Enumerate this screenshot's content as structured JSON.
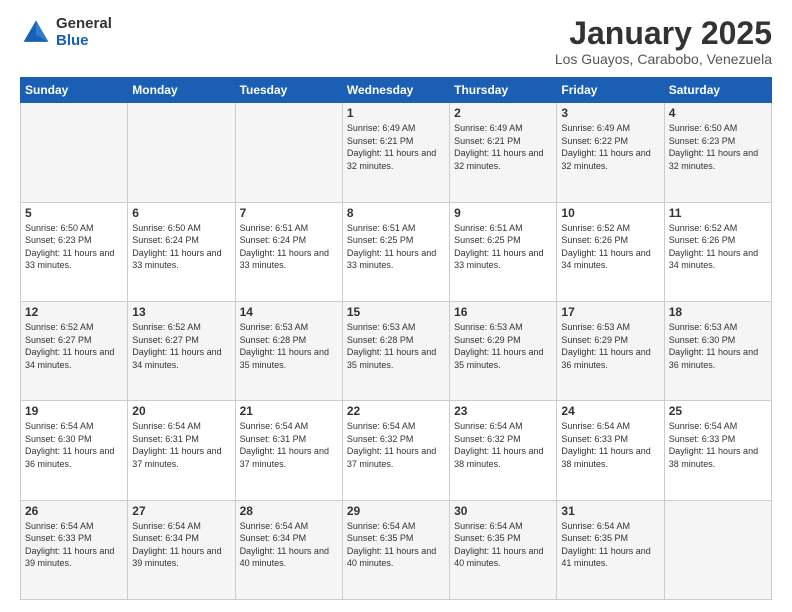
{
  "header": {
    "logo_general": "General",
    "logo_blue": "Blue",
    "title": "January 2025",
    "subtitle": "Los Guayos, Carabobo, Venezuela"
  },
  "weekdays": [
    "Sunday",
    "Monday",
    "Tuesday",
    "Wednesday",
    "Thursday",
    "Friday",
    "Saturday"
  ],
  "weeks": [
    [
      {
        "day": "",
        "info": ""
      },
      {
        "day": "",
        "info": ""
      },
      {
        "day": "",
        "info": ""
      },
      {
        "day": "1",
        "info": "Sunrise: 6:49 AM\nSunset: 6:21 PM\nDaylight: 11 hours and 32 minutes."
      },
      {
        "day": "2",
        "info": "Sunrise: 6:49 AM\nSunset: 6:21 PM\nDaylight: 11 hours and 32 minutes."
      },
      {
        "day": "3",
        "info": "Sunrise: 6:49 AM\nSunset: 6:22 PM\nDaylight: 11 hours and 32 minutes."
      },
      {
        "day": "4",
        "info": "Sunrise: 6:50 AM\nSunset: 6:23 PM\nDaylight: 11 hours and 32 minutes."
      }
    ],
    [
      {
        "day": "5",
        "info": "Sunrise: 6:50 AM\nSunset: 6:23 PM\nDaylight: 11 hours and 33 minutes."
      },
      {
        "day": "6",
        "info": "Sunrise: 6:50 AM\nSunset: 6:24 PM\nDaylight: 11 hours and 33 minutes."
      },
      {
        "day": "7",
        "info": "Sunrise: 6:51 AM\nSunset: 6:24 PM\nDaylight: 11 hours and 33 minutes."
      },
      {
        "day": "8",
        "info": "Sunrise: 6:51 AM\nSunset: 6:25 PM\nDaylight: 11 hours and 33 minutes."
      },
      {
        "day": "9",
        "info": "Sunrise: 6:51 AM\nSunset: 6:25 PM\nDaylight: 11 hours and 33 minutes."
      },
      {
        "day": "10",
        "info": "Sunrise: 6:52 AM\nSunset: 6:26 PM\nDaylight: 11 hours and 34 minutes."
      },
      {
        "day": "11",
        "info": "Sunrise: 6:52 AM\nSunset: 6:26 PM\nDaylight: 11 hours and 34 minutes."
      }
    ],
    [
      {
        "day": "12",
        "info": "Sunrise: 6:52 AM\nSunset: 6:27 PM\nDaylight: 11 hours and 34 minutes."
      },
      {
        "day": "13",
        "info": "Sunrise: 6:52 AM\nSunset: 6:27 PM\nDaylight: 11 hours and 34 minutes."
      },
      {
        "day": "14",
        "info": "Sunrise: 6:53 AM\nSunset: 6:28 PM\nDaylight: 11 hours and 35 minutes."
      },
      {
        "day": "15",
        "info": "Sunrise: 6:53 AM\nSunset: 6:28 PM\nDaylight: 11 hours and 35 minutes."
      },
      {
        "day": "16",
        "info": "Sunrise: 6:53 AM\nSunset: 6:29 PM\nDaylight: 11 hours and 35 minutes."
      },
      {
        "day": "17",
        "info": "Sunrise: 6:53 AM\nSunset: 6:29 PM\nDaylight: 11 hours and 36 minutes."
      },
      {
        "day": "18",
        "info": "Sunrise: 6:53 AM\nSunset: 6:30 PM\nDaylight: 11 hours and 36 minutes."
      }
    ],
    [
      {
        "day": "19",
        "info": "Sunrise: 6:54 AM\nSunset: 6:30 PM\nDaylight: 11 hours and 36 minutes."
      },
      {
        "day": "20",
        "info": "Sunrise: 6:54 AM\nSunset: 6:31 PM\nDaylight: 11 hours and 37 minutes."
      },
      {
        "day": "21",
        "info": "Sunrise: 6:54 AM\nSunset: 6:31 PM\nDaylight: 11 hours and 37 minutes."
      },
      {
        "day": "22",
        "info": "Sunrise: 6:54 AM\nSunset: 6:32 PM\nDaylight: 11 hours and 37 minutes."
      },
      {
        "day": "23",
        "info": "Sunrise: 6:54 AM\nSunset: 6:32 PM\nDaylight: 11 hours and 38 minutes."
      },
      {
        "day": "24",
        "info": "Sunrise: 6:54 AM\nSunset: 6:33 PM\nDaylight: 11 hours and 38 minutes."
      },
      {
        "day": "25",
        "info": "Sunrise: 6:54 AM\nSunset: 6:33 PM\nDaylight: 11 hours and 38 minutes."
      }
    ],
    [
      {
        "day": "26",
        "info": "Sunrise: 6:54 AM\nSunset: 6:33 PM\nDaylight: 11 hours and 39 minutes."
      },
      {
        "day": "27",
        "info": "Sunrise: 6:54 AM\nSunset: 6:34 PM\nDaylight: 11 hours and 39 minutes."
      },
      {
        "day": "28",
        "info": "Sunrise: 6:54 AM\nSunset: 6:34 PM\nDaylight: 11 hours and 40 minutes."
      },
      {
        "day": "29",
        "info": "Sunrise: 6:54 AM\nSunset: 6:35 PM\nDaylight: 11 hours and 40 minutes."
      },
      {
        "day": "30",
        "info": "Sunrise: 6:54 AM\nSunset: 6:35 PM\nDaylight: 11 hours and 40 minutes."
      },
      {
        "day": "31",
        "info": "Sunrise: 6:54 AM\nSunset: 6:35 PM\nDaylight: 11 hours and 41 minutes."
      },
      {
        "day": "",
        "info": ""
      }
    ]
  ]
}
